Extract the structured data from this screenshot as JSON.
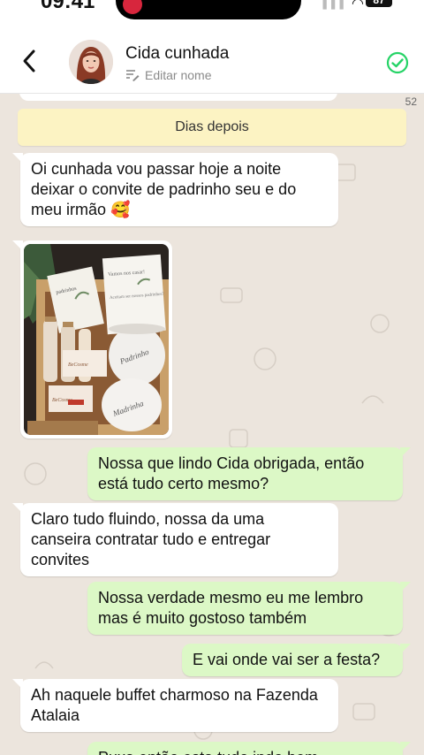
{
  "status_bar": {
    "time": "09:41",
    "signal_text": "▌▌▌",
    "battery": "87"
  },
  "header": {
    "contact_name": "Cida cunhada",
    "edit_label": "Editar nome"
  },
  "chat": {
    "counter": "52",
    "day_banner": "Dias depois",
    "messages": [
      {
        "dir": "in",
        "text": "Oi cunhada vou passar hoje a noite deixar o convite de padrinho seu e do meu irmão 🥰"
      },
      {
        "dir": "in",
        "type": "image",
        "caption": ""
      },
      {
        "dir": "out",
        "text": "Nossa que lindo Cida obrigada, então está tudo certo mesmo?"
      },
      {
        "dir": "in",
        "text": "Claro tudo fluindo, nossa da uma canseira contratar tudo e entregar convites"
      },
      {
        "dir": "out",
        "text": "Nossa verdade mesmo eu me lembro mas é muito gostoso também"
      },
      {
        "dir": "out",
        "text": "E vai onde vai ser a festa?"
      },
      {
        "dir": "in",
        "text": "Ah naquele buffet charmoso na Fazenda Atalaia"
      },
      {
        "dir": "out",
        "text": "Puxa então esta tudo indo bem"
      }
    ]
  },
  "photo_text": {
    "card1": "Vamos nos casar!",
    "card2": "Aceitam ser nossos padrinhos?",
    "card3": "padrinhos",
    "mug1": "Padrinho",
    "mug2": "Madrinha",
    "tag1": "BeCosme",
    "tag2": "BeCosme"
  },
  "colors": {
    "incoming": "#ffffff",
    "outgoing": "#dcf8c6",
    "chat_bg": "#ece5dd",
    "banner": "#fcf3c3",
    "accent_green": "#25d366"
  },
  "icons": [
    "back-chevron-icon",
    "edit-name-icon",
    "verified-check-icon",
    "wifi-icon",
    "battery-icon"
  ]
}
